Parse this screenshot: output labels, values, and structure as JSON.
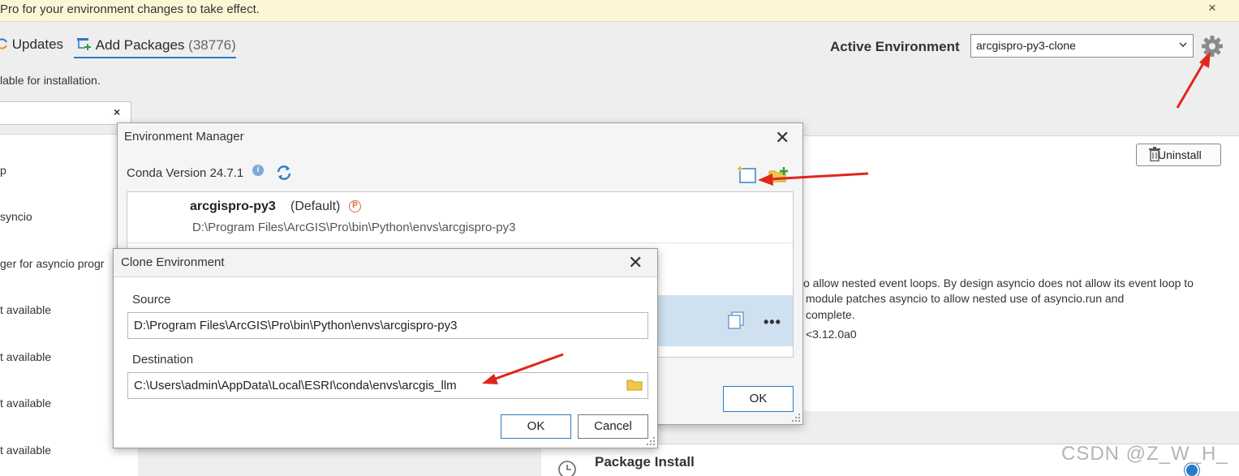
{
  "banner": {
    "text": "Pro for your environment changes to take effect.",
    "close": "×"
  },
  "tabs": [
    {
      "label": "Updates"
    },
    {
      "label": "Add Packages",
      "count": "(38776)"
    }
  ],
  "available_text": "lable for installation.",
  "search": {
    "clear": "×"
  },
  "left_list": [
    "p",
    "syncio",
    "ger for asyncio progr",
    "t available",
    "t available",
    "t available",
    "t available"
  ],
  "active_environment": {
    "label": "Active Environment",
    "value": "arcgispro-py3-clone"
  },
  "details": {
    "uninstall_label": "Uninstall",
    "description_lines": [
      "o allow nested event loops. By design asyncio does not allow its event loop to",
      "module patches asyncio to allow nested use of asyncio.run and",
      "complete.",
      "<3.12.0a0"
    ]
  },
  "package_install": {
    "title": "Package Install"
  },
  "watermark": "CSDN @Z_W_H_",
  "env_manager": {
    "title": "Environment Manager",
    "close": "✕",
    "conda_version": "Conda Version 24.7.1",
    "info_glyph": "i",
    "environments": [
      {
        "name": "arcgispro-py3",
        "default_label": "(Default)",
        "badge": "P",
        "path": "D:\\Program Files\\ArcGIS\\Pro\\bin\\Python\\envs\\arcgispro-py3"
      }
    ],
    "more": "•••",
    "ok": "OK"
  },
  "clone_dialog": {
    "title": "Clone Environment",
    "close": "✕",
    "source_label": "Source",
    "source_value": "D:\\Program Files\\ArcGIS\\Pro\\bin\\Python\\envs\\arcgispro-py3",
    "destination_label": "Destination",
    "destination_value": "C:\\Users\\admin\\AppData\\Local\\ESRI\\conda\\envs\\arcgis_llm",
    "ok": "OK",
    "cancel": "Cancel"
  },
  "colors": {
    "accent": "#2a7ac9",
    "selection": "#cfe1f1",
    "banner": "#fdf6d5",
    "annotation_arrow": "#e0261b"
  }
}
